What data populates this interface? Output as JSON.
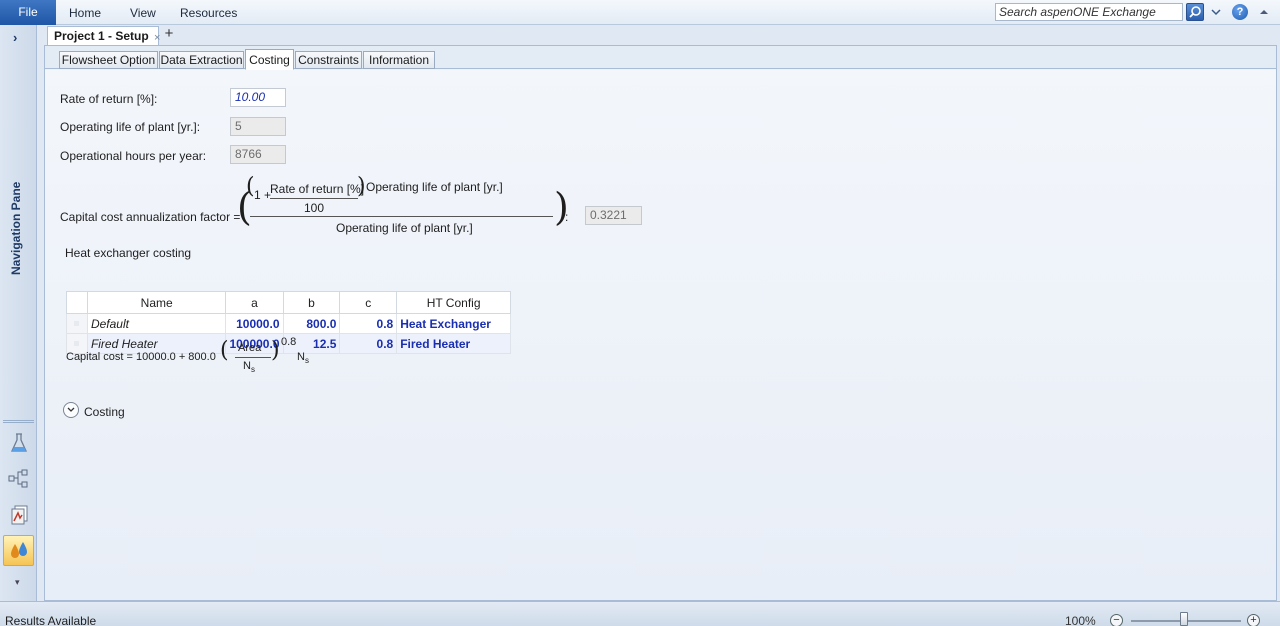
{
  "menubar": {
    "file": "File",
    "items": [
      "Home",
      "View",
      "Resources"
    ],
    "search_placeholder": "Search aspenONE Exchange"
  },
  "nav": {
    "label": "Navigation Pane",
    "chevron": "›",
    "more": "▾",
    "buttons": [
      "flask-icon",
      "flowsheet-icon",
      "report-icon",
      "energy-icon"
    ]
  },
  "doc": {
    "tab_title": "Project 1 - Setup",
    "close": "×",
    "add": "+"
  },
  "subtabs": [
    "Flowsheet Option",
    "Data Extraction",
    "Costing",
    "Constraints",
    "Information"
  ],
  "active_subtab": "Costing",
  "form": {
    "rate_label": "Rate of return [%]:",
    "rate_value": "10.00",
    "life_label": "Operating life of plant [yr.]:",
    "life_value": "5",
    "hours_label": "Operational hours per year:",
    "hours_value": "8766"
  },
  "formula": {
    "label": "Capital cost annualization factor =",
    "one_plus": "1 +",
    "rate": "Rate of return [%]",
    "hundred": "100",
    "exponent": "Operating life of plant [yr.]",
    "denominator": "Operating life of plant [yr.]",
    "colon": ":",
    "result": "0.3221"
  },
  "heat_exchanger": {
    "title": "Heat exchanger costing",
    "columns": [
      "Name",
      "a",
      "b",
      "c",
      "HT Config"
    ],
    "rows": [
      {
        "name": "Default",
        "a": "10000.0",
        "b": "800.0",
        "c": "0.8",
        "config": "Heat Exchanger"
      },
      {
        "name": "Fired Heater",
        "a": "100000.0",
        "b": "12.5",
        "c": "0.8",
        "config": "Fired Heater"
      }
    ]
  },
  "capital_formula": {
    "prefix": "Capital cost = 10000.0  +  800.0",
    "area": "Area",
    "ns": "N",
    "sub": "s",
    "exponent": "0.8",
    "trail_n": "N",
    "trail_sub": "s"
  },
  "costing_section": {
    "label": "Costing",
    "chevron": "⌄"
  },
  "statusbar": {
    "text": "Results Available",
    "zoom": "100%",
    "minus": "−",
    "plus": "+"
  }
}
